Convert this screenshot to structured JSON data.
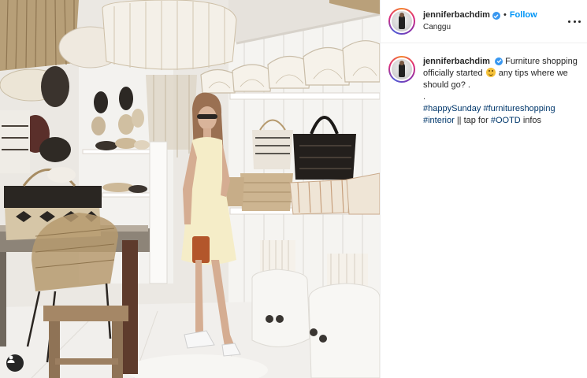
{
  "post": {
    "username": "jenniferbachdim",
    "follow_label": "Follow",
    "separator": "•",
    "location": "Canggu"
  },
  "caption": {
    "username": "jenniferbachdim",
    "text_part1": "Furniture shopping officially started",
    "emoji": "smiling-face-emoji",
    "text_part2": "any tips where we should go? .",
    "dot_line": ".",
    "hashtag1": "#happySunday",
    "hashtag2": "#furnitureshopping",
    "hashtag3": "#interior",
    "text_part3": "|| tap for",
    "hashtag4": "#OOTD",
    "text_part4": "infos"
  },
  "icons": {
    "verified": "verified-badge-icon",
    "more": "more-options-icon",
    "user_tag": "user-tag-icon"
  },
  "colors": {
    "link_blue": "#0095f6",
    "hashtag": "#00376b",
    "verified": "#3897f0",
    "text": "#262626"
  }
}
